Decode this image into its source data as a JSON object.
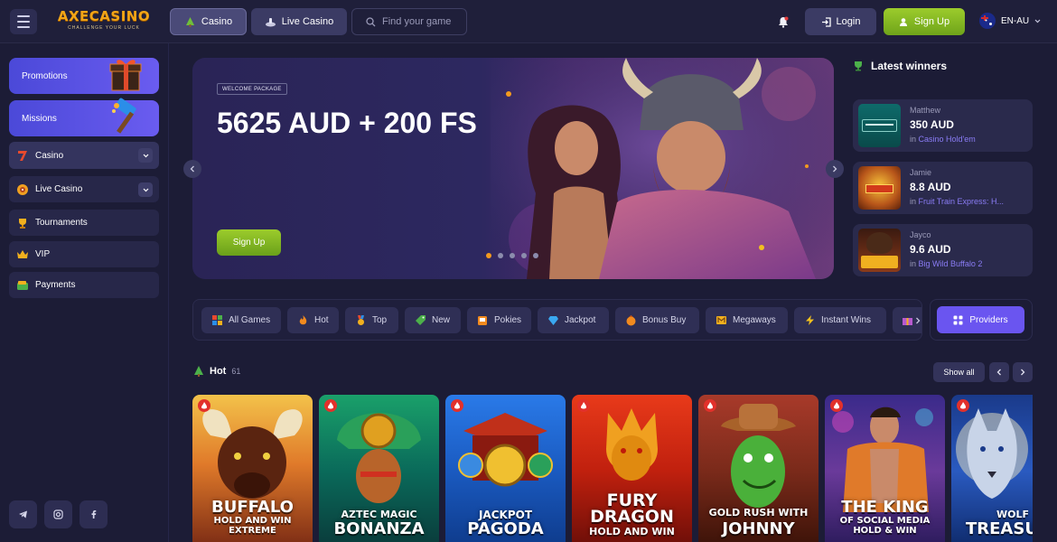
{
  "header": {
    "logo_text": "AXECASINO",
    "logo_tagline": "CHALLENGE YOUR LUCK",
    "nav_casino": "Casino",
    "nav_live_casino": "Live Casino",
    "search_placeholder": "Find your game",
    "login_label": "Login",
    "signup_label": "Sign Up",
    "language": "EN-AU"
  },
  "sidebar": {
    "promotions": "Promotions",
    "missions": "Missions",
    "items": [
      {
        "label": "Casino"
      },
      {
        "label": "Live Casino"
      },
      {
        "label": "Tournaments"
      },
      {
        "label": "VIP"
      },
      {
        "label": "Payments"
      }
    ]
  },
  "hero": {
    "tag": "WELCOME PACKAGE",
    "title": "5625 AUD + 200 FS",
    "button": "Sign Up",
    "slides": 5,
    "active_slide": 1
  },
  "winners": {
    "title": "Latest winners",
    "list": [
      {
        "name": "Matthew",
        "amount": "350 AUD",
        "in_label": "in",
        "game": "Casino Hold'em"
      },
      {
        "name": "Jamie",
        "amount": "8.8 AUD",
        "in_label": "in",
        "game": "Fruit Train Express: H..."
      },
      {
        "name": "Jayco",
        "amount": "9.6 AUD",
        "in_label": "in",
        "game": "Big Wild Buffalo 2"
      }
    ]
  },
  "categories": {
    "items": [
      {
        "label": "All Games"
      },
      {
        "label": "Hot"
      },
      {
        "label": "Top"
      },
      {
        "label": "New"
      },
      {
        "label": "Pokies"
      },
      {
        "label": "Jackpot"
      },
      {
        "label": "Bonus Buy"
      },
      {
        "label": "Megaways"
      },
      {
        "label": "Instant Wins"
      }
    ],
    "providers_label": "Providers"
  },
  "hot_section": {
    "title": "Hot",
    "count": "61",
    "show_all": "Show all",
    "games": [
      {
        "line1": "BUFFALO",
        "line2": "HOLD AND WIN EXTREME"
      },
      {
        "line1": "AZTEC MAGIC",
        "line2": "BONANZA"
      },
      {
        "line1": "JACKPOT",
        "line2": "PAGODA"
      },
      {
        "line1": "FURY DRAGON",
        "line2": "HOLD AND WIN"
      },
      {
        "line1": "GOLD RUSH WITH",
        "line2": "JOHNNY"
      },
      {
        "line1": "THE KING",
        "line2": "OF SOCIAL MEDIA HOLD & WIN"
      },
      {
        "line1": "WOLF",
        "line2": "TREASU"
      }
    ]
  },
  "colors": {
    "background": "#1c1c36",
    "accent_green": "#8cc327",
    "accent_purple": "#6a55f0",
    "brand_orange": "#f2a516"
  }
}
